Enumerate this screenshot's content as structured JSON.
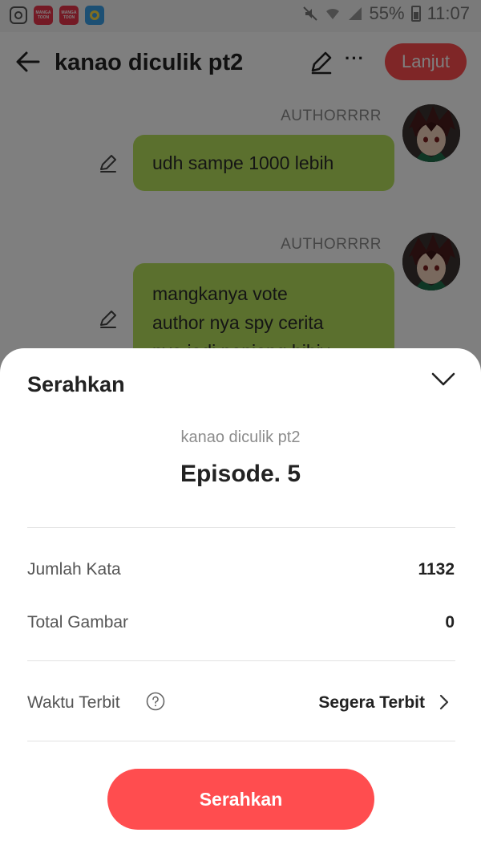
{
  "status_bar": {
    "battery": "55%",
    "time": "11:07",
    "app_icon_text": [
      "MANGA",
      "TOON"
    ]
  },
  "editor": {
    "title": "kanao diculik pt2",
    "next_label": "Lanjut",
    "more_label": "···"
  },
  "messages": [
    {
      "author": "AUTHORRRR",
      "text": "udh sampe 1000 lebih"
    },
    {
      "author": "AUTHORRRR",
      "lines": [
        "mangkanya vote",
        "author nya spy cerita",
        "nya jadi panjang hihiy"
      ]
    }
  ],
  "sheet": {
    "title": "Serahkan",
    "story_name": "kanao diculik pt2",
    "episode": "Episode. 5",
    "word_count_label": "Jumlah Kata",
    "word_count_value": "1132",
    "images_label": "Total Gambar",
    "images_value": "0",
    "publish_time_label": "Waktu Terbit",
    "publish_time_value": "Segera Terbit",
    "submit_label": "Serahkan"
  },
  "colors": {
    "accent": "#ff4d4f",
    "bubble": "#b6e15c",
    "overlay": "rgba(0,0,0,0.5)"
  },
  "icons": [
    "instagram-icon",
    "mangatoon-icon",
    "app-icon",
    "mute-icon",
    "wifi-icon",
    "signal-icon",
    "battery-icon",
    "back-arrow-icon",
    "pencil-icon",
    "more-icon",
    "avatar",
    "chevron-down-icon",
    "help-circle-icon",
    "chevron-right-icon"
  ]
}
